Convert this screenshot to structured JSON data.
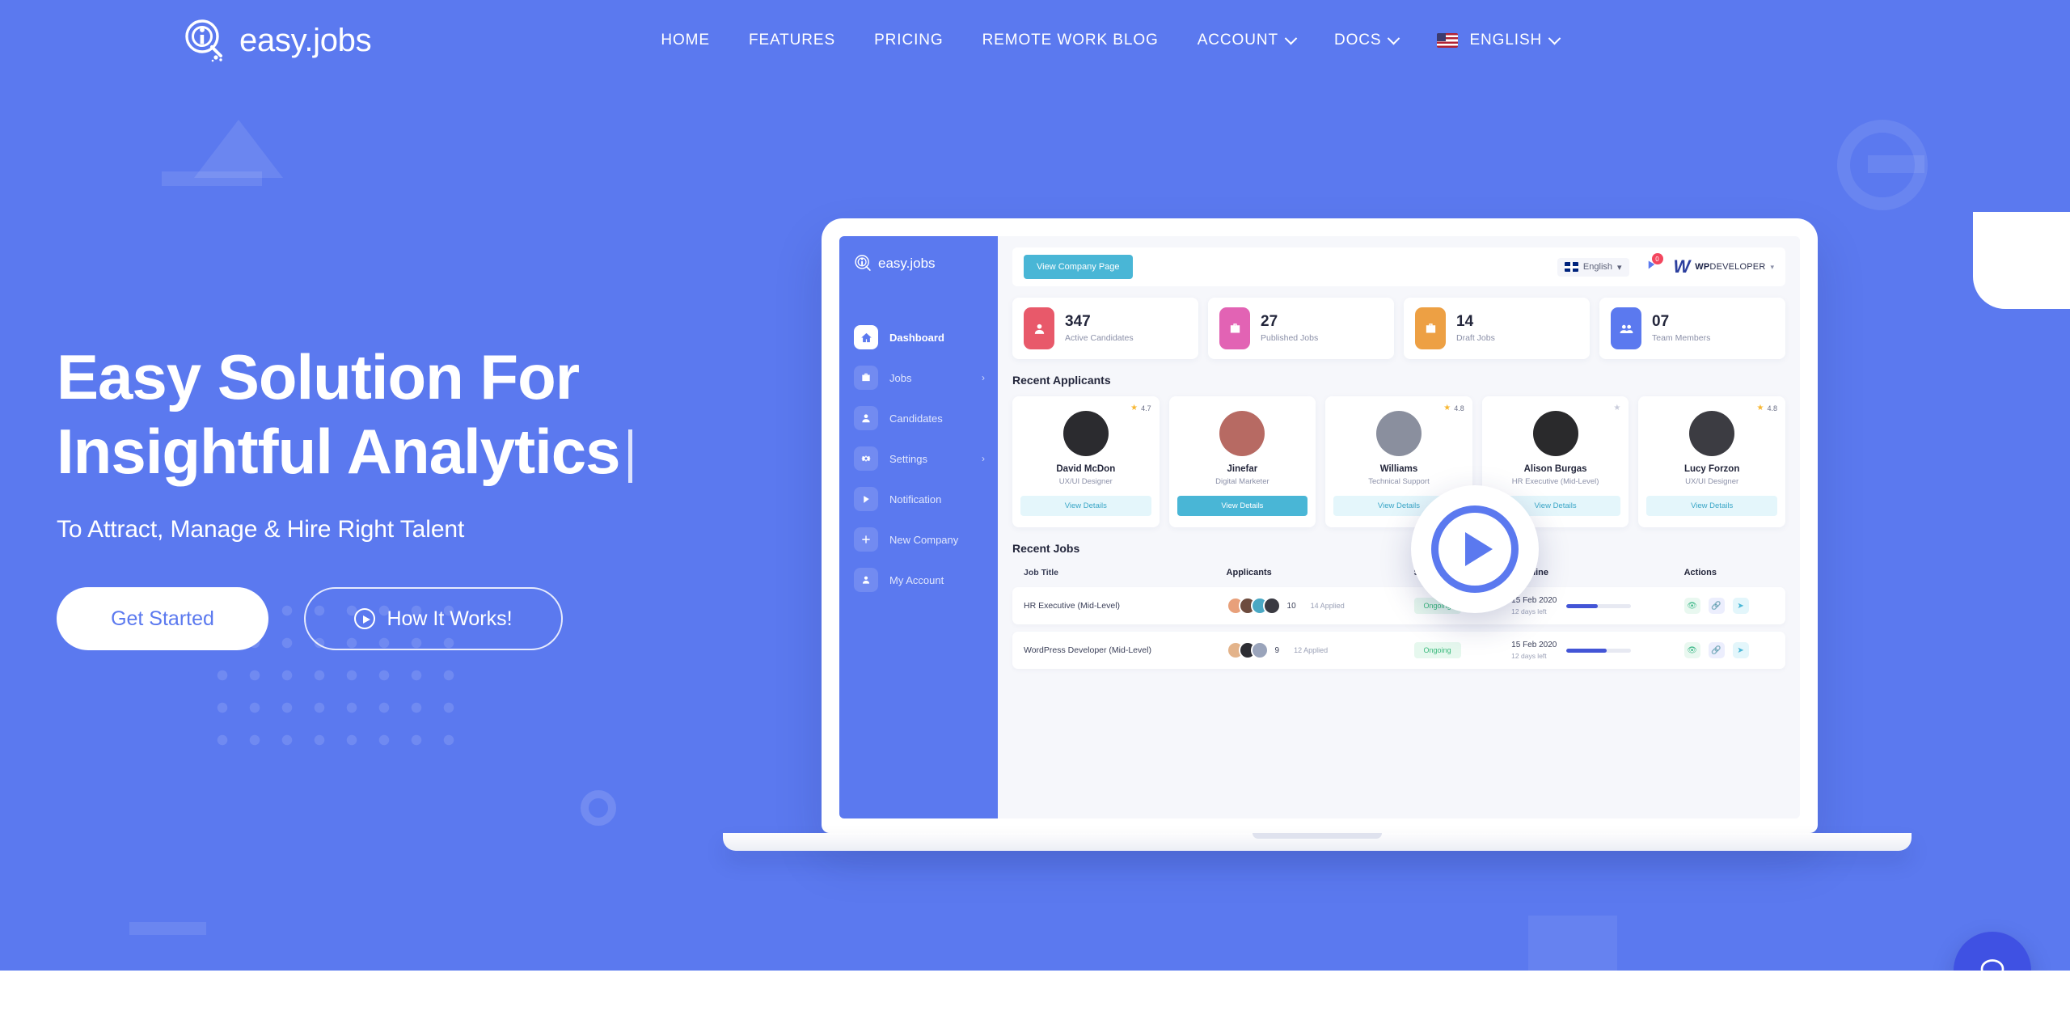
{
  "brand": {
    "name": "easy.jobs",
    "logo_icon": "magnifier-i-logo"
  },
  "nav": {
    "items": [
      {
        "label": "HOME",
        "has_caret": false
      },
      {
        "label": "FEATURES",
        "has_caret": false
      },
      {
        "label": "PRICING",
        "has_caret": false
      },
      {
        "label": "REMOTE WORK BLOG",
        "has_caret": false
      },
      {
        "label": "ACCOUNT",
        "has_caret": true
      },
      {
        "label": "DOCS",
        "has_caret": true
      }
    ],
    "language": {
      "label": "ENGLISH",
      "flag": "us-flag"
    }
  },
  "hero": {
    "headline": "Easy Solution For\nInsightful Analytics",
    "subhead": "To Attract, Manage & Hire Right Talent",
    "primary_cta": "Get Started",
    "secondary_cta": "How It Works!",
    "play_icon": "play-icon",
    "background_color": "#5b79ef"
  },
  "dashboard": {
    "brand": "easy.jobs",
    "sidebar": [
      {
        "label": "Dashboard",
        "icon": "home-icon",
        "active": true,
        "chevron": false
      },
      {
        "label": "Jobs",
        "icon": "briefcase-icon",
        "active": false,
        "chevron": true
      },
      {
        "label": "Candidates",
        "icon": "user-icon",
        "active": false,
        "chevron": false
      },
      {
        "label": "Settings",
        "icon": "gear-icon",
        "active": false,
        "chevron": true
      },
      {
        "label": "Notification",
        "icon": "bell-icon",
        "active": false,
        "chevron": false
      },
      {
        "label": "New Company",
        "icon": "plus-icon",
        "active": false,
        "chevron": false
      },
      {
        "label": "My Account",
        "icon": "account-icon",
        "active": false,
        "chevron": false
      }
    ],
    "topbar": {
      "view_company_button": "View Company Page",
      "language": "English",
      "language_flag": "uk-flag",
      "notification_count": "0",
      "org_name_light": "WP",
      "org_name_rest": "DEVELOPER"
    },
    "stats": [
      {
        "value": "347",
        "label": "Active Candidates",
        "color": "#e8596a",
        "icon": "candidate-icon"
      },
      {
        "value": "27",
        "label": "Published Jobs",
        "color": "#e263b4",
        "icon": "briefcase-icon"
      },
      {
        "value": "14",
        "label": "Draft Jobs",
        "color": "#eda044",
        "icon": "briefcase-icon"
      },
      {
        "value": "07",
        "label": "Team Members",
        "color": "#5b79ef",
        "icon": "team-icon"
      }
    ],
    "applicants_title": "Recent Applicants",
    "applicants": [
      {
        "name": "David McDon",
        "role": "UX/UI Designer",
        "rating": "4.7",
        "button": "View Details",
        "solid": false,
        "avatar_color": "#2b2b2f"
      },
      {
        "name": "Jinefar",
        "role": "Digital Marketer",
        "rating": "",
        "button": "View Details",
        "solid": true,
        "avatar_color": "#b76a63"
      },
      {
        "name": "Williams",
        "role": "Technical Support",
        "rating": "4.8",
        "button": "View Details",
        "solid": false,
        "avatar_color": "#8a8f9e"
      },
      {
        "name": "Alison Burgas",
        "role": "HR Executive (Mid-Level)",
        "rating": "",
        "button": "View Details",
        "solid": false,
        "avatar_color": "#2a2a2c"
      },
      {
        "name": "Lucy Forzon",
        "role": "UX/UI Designer",
        "rating": "4.8",
        "button": "View Details",
        "solid": false,
        "avatar_color": "#3c3c42"
      }
    ],
    "jobs_title": "Recent Jobs",
    "jobs_columns": [
      "Job Title",
      "Applicants",
      "Status",
      "Deadline",
      "Actions"
    ],
    "jobs": [
      {
        "title": "HR Executive (Mid-Level)",
        "applicant_count": "10",
        "applied": "14 Applied",
        "status": "Ongoing",
        "deadline": "15 Feb 2020",
        "days_left": "12 days left",
        "progress": 48,
        "actions": [
          "eye-icon",
          "link-icon",
          "share-icon"
        ]
      },
      {
        "title": "WordPress Developer (Mid-Level)",
        "applicant_count": "9",
        "applied": "12 Applied",
        "status": "Ongoing",
        "deadline": "15 Feb 2020",
        "days_left": "12 days left",
        "progress": 62,
        "actions": [
          "eye-icon",
          "link-icon",
          "share-icon"
        ]
      }
    ]
  },
  "chat": {
    "icon": "chat-bubble-icon",
    "color": "#3f51e3"
  }
}
